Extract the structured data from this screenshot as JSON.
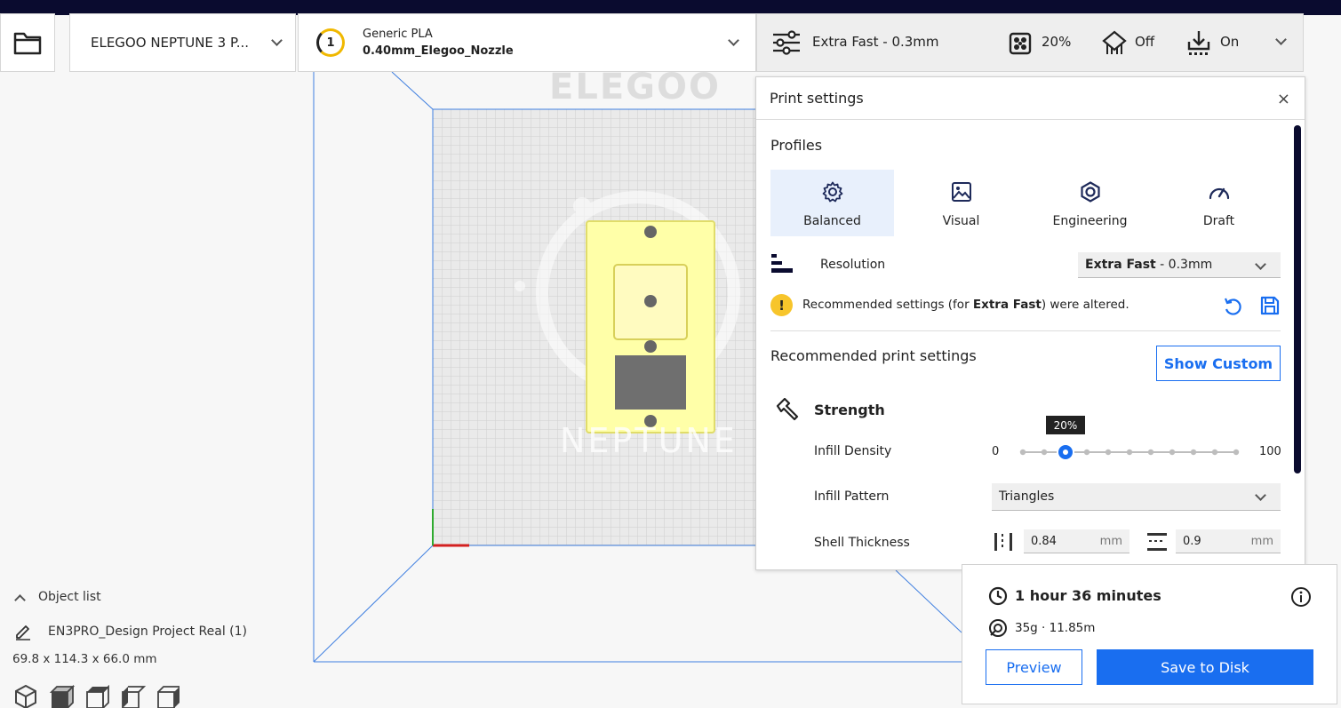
{
  "toolbar": {
    "printer": "ELEGOO NEPTUNE 3 P...",
    "extruder_number": "1",
    "material": "Generic PLA",
    "nozzle": "0.40mm_Elegoo_Nozzle",
    "profile": "Extra Fast - 0.3mm",
    "infill": "20%",
    "support": "Off",
    "adhesion": "On"
  },
  "viewport": {
    "brand_top": "ELEGOO",
    "brand_bottom": "NEPTUNE"
  },
  "print_settings": {
    "title": "Print settings",
    "close": "×",
    "profiles_heading": "Profiles",
    "profiles": [
      {
        "label": "Balanced",
        "icon": "gear-icon",
        "active": true
      },
      {
        "label": "Visual",
        "icon": "image-icon",
        "active": false
      },
      {
        "label": "Engineering",
        "icon": "hexagon-nut-icon",
        "active": false
      },
      {
        "label": "Draft",
        "icon": "speedometer-icon",
        "active": false
      }
    ],
    "resolution_label": "Resolution",
    "resolution_value_bold": "Extra Fast",
    "resolution_value_rest": " - 0.3mm",
    "warning_prefix": "Recommended settings (for ",
    "warning_bold": "Extra Fast",
    "warning_suffix": ") were altered.",
    "recommended_heading": "Recommended print settings",
    "show_custom": "Show Custom",
    "strength_heading": "Strength",
    "infill_density_label": "Infill Density",
    "infill_min": "0",
    "infill_max": "100",
    "infill_value": 20,
    "infill_tooltip": "20%",
    "infill_pattern_label": "Infill Pattern",
    "infill_pattern_value": "Triangles",
    "shell_thickness_label": "Shell Thickness",
    "wall_thickness": "0.84",
    "top_bottom_thickness": "0.9",
    "unit": "mm"
  },
  "summary": {
    "time": "1 hour 36 minutes",
    "material_usage": "35g · 11.85m",
    "preview": "Preview",
    "save": "Save to Disk"
  },
  "objects": {
    "list_label": "Object list",
    "name": "EN3PRO_Design Project Real (1)",
    "dimensions": "69.8 x 114.3 x 66.0 mm"
  },
  "colors": {
    "accent": "#196ef0",
    "dark": "#0a0b2f",
    "warning": "#f7c52b",
    "model": "#ffffa8"
  }
}
